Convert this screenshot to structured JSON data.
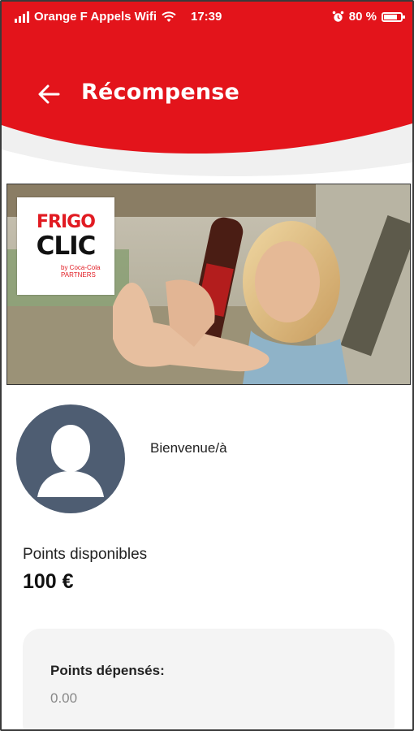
{
  "status_bar": {
    "carrier": "Orange F Appels Wifi",
    "time": "17:39",
    "battery": "80 %",
    "battery_level": 0.8
  },
  "header": {
    "title": "Récompense",
    "accent_color": "#e3141b"
  },
  "banner": {
    "logo_line1": "FRIGO",
    "logo_line2": "CLIC",
    "logo_sub": "by Coca-Cola PARTNERS"
  },
  "profile": {
    "welcome": "Bienvenue/à"
  },
  "points": {
    "label": "Points disponibles",
    "value": "100 €"
  },
  "spent_card": {
    "label": "Points dépensés:",
    "value": "0.00"
  }
}
